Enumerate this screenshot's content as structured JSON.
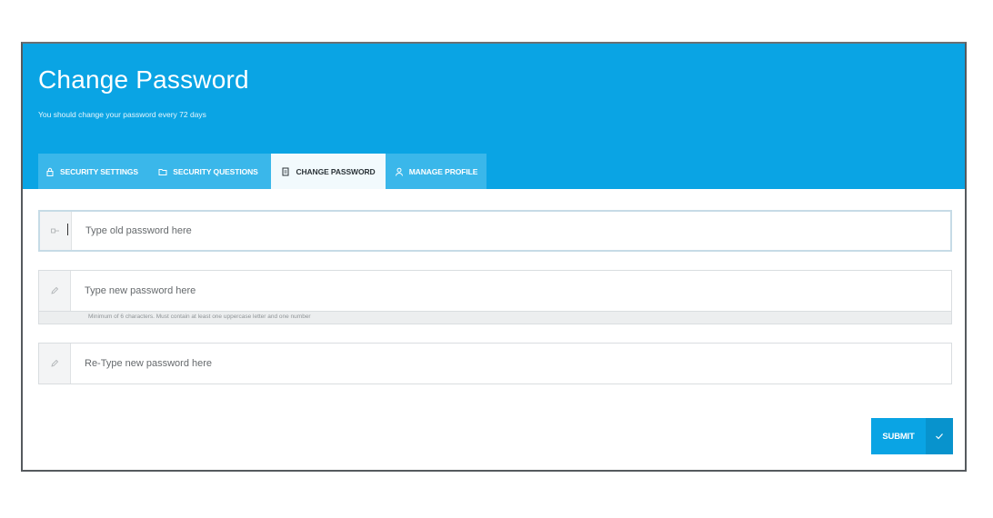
{
  "header": {
    "title": "Change Password",
    "subtitle": "You should change your password every 72 days"
  },
  "tabs": [
    {
      "label": "SECURITY SETTINGS",
      "icon": "lock-icon",
      "active": false
    },
    {
      "label": "SECURITY QUESTIONS",
      "icon": "folder-icon",
      "active": false
    },
    {
      "label": "CHANGE PASSWORD",
      "icon": "document-icon",
      "active": true
    },
    {
      "label": "MANAGE PROFILE",
      "icon": "user-icon",
      "active": false
    }
  ],
  "form": {
    "old_password": {
      "placeholder": "Type old password here",
      "value": "",
      "icon": "key-icon"
    },
    "new_password": {
      "placeholder": "Type new password here",
      "value": "",
      "icon": "pencil-icon"
    },
    "hint": "Minimum of 6 characters. Must contain at least one uppercase letter and one number",
    "retype_password": {
      "placeholder": "Re-Type new password here",
      "value": "",
      "icon": "pencil-icon"
    }
  },
  "submit": {
    "label": "SUBMIT",
    "icon": "checkmark-icon"
  },
  "colors": {
    "brand": "#0aa4e4",
    "tab_inactive": "#3ab7ea",
    "tab_active": "#f2fafd",
    "submit_check": "#0893cd"
  }
}
